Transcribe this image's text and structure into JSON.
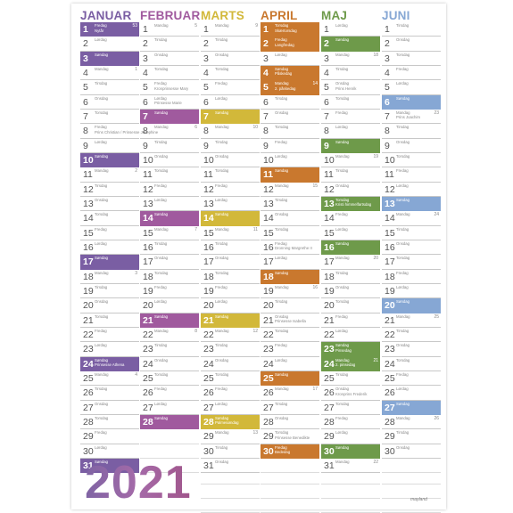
{
  "year": "2021",
  "brand": "mayland",
  "months": [
    {
      "name": "JANUAR",
      "color": "#7a5ea3",
      "days": [
        {
          "d": "1",
          "wd": "Fredag",
          "hol": "Nytår",
          "wk": "53",
          "hl": true
        },
        {
          "d": "2",
          "wd": "Lørdag"
        },
        {
          "d": "3",
          "wd": "Søndag",
          "hl": true
        },
        {
          "d": "4",
          "wd": "Mandag",
          "wk": "1"
        },
        {
          "d": "5",
          "wd": "Tirsdag"
        },
        {
          "d": "6",
          "wd": "Onsdag"
        },
        {
          "d": "7",
          "wd": "Torsdag"
        },
        {
          "d": "8",
          "wd": "Fredag",
          "hol": "Prins Christian / Prinsesse Josephine"
        },
        {
          "d": "9",
          "wd": "Lørdag"
        },
        {
          "d": "10",
          "wd": "Søndag",
          "hl": true
        },
        {
          "d": "11",
          "wd": "Mandag",
          "wk": "2"
        },
        {
          "d": "12",
          "wd": "Tirsdag"
        },
        {
          "d": "13",
          "wd": "Onsdag"
        },
        {
          "d": "14",
          "wd": "Torsdag"
        },
        {
          "d": "15",
          "wd": "Fredag"
        },
        {
          "d": "16",
          "wd": "Lørdag"
        },
        {
          "d": "17",
          "wd": "Søndag",
          "hl": true
        },
        {
          "d": "18",
          "wd": "Mandag",
          "wk": "3"
        },
        {
          "d": "19",
          "wd": "Tirsdag"
        },
        {
          "d": "20",
          "wd": "Onsdag"
        },
        {
          "d": "21",
          "wd": "Torsdag"
        },
        {
          "d": "22",
          "wd": "Fredag"
        },
        {
          "d": "23",
          "wd": "Lørdag"
        },
        {
          "d": "24",
          "wd": "Søndag",
          "hol": "Prinsesse Athena",
          "hl": true
        },
        {
          "d": "25",
          "wd": "Mandag",
          "wk": "4"
        },
        {
          "d": "26",
          "wd": "Tirsdag"
        },
        {
          "d": "27",
          "wd": "Onsdag"
        },
        {
          "d": "28",
          "wd": "Torsdag"
        },
        {
          "d": "29",
          "wd": "Fredag"
        },
        {
          "d": "30",
          "wd": "Lørdag"
        },
        {
          "d": "31",
          "wd": "Søndag",
          "hl": true
        }
      ]
    },
    {
      "name": "FEBRUAR",
      "color": "#a05a9e",
      "days": [
        {
          "d": "1",
          "wd": "Mandag",
          "wk": "5"
        },
        {
          "d": "2",
          "wd": "Tirsdag"
        },
        {
          "d": "3",
          "wd": "Onsdag"
        },
        {
          "d": "4",
          "wd": "Torsdag"
        },
        {
          "d": "5",
          "wd": "Fredag",
          "hol": "Kronprinsesse Mary"
        },
        {
          "d": "6",
          "wd": "Lørdag",
          "hol": "Prinsesse Marie"
        },
        {
          "d": "7",
          "wd": "Søndag",
          "hl": true
        },
        {
          "d": "8",
          "wd": "Mandag",
          "wk": "6"
        },
        {
          "d": "9",
          "wd": "Tirsdag"
        },
        {
          "d": "10",
          "wd": "Onsdag"
        },
        {
          "d": "11",
          "wd": "Torsdag"
        },
        {
          "d": "12",
          "wd": "Fredag"
        },
        {
          "d": "13",
          "wd": "Lørdag"
        },
        {
          "d": "14",
          "wd": "Søndag",
          "hl": true
        },
        {
          "d": "15",
          "wd": "Mandag",
          "wk": "7"
        },
        {
          "d": "16",
          "wd": "Tirsdag"
        },
        {
          "d": "17",
          "wd": "Onsdag"
        },
        {
          "d": "18",
          "wd": "Torsdag"
        },
        {
          "d": "19",
          "wd": "Fredag"
        },
        {
          "d": "20",
          "wd": "Lørdag"
        },
        {
          "d": "21",
          "wd": "Søndag",
          "hl": true
        },
        {
          "d": "22",
          "wd": "Mandag",
          "wk": "8"
        },
        {
          "d": "23",
          "wd": "Tirsdag"
        },
        {
          "d": "24",
          "wd": "Onsdag"
        },
        {
          "d": "25",
          "wd": "Torsdag"
        },
        {
          "d": "26",
          "wd": "Fredag"
        },
        {
          "d": "27",
          "wd": "Lørdag"
        },
        {
          "d": "28",
          "wd": "Søndag",
          "hl": true
        }
      ]
    },
    {
      "name": "MARTS",
      "color": "#d2b83a",
      "days": [
        {
          "d": "1",
          "wd": "Mandag",
          "wk": "9"
        },
        {
          "d": "2",
          "wd": "Tirsdag"
        },
        {
          "d": "3",
          "wd": "Onsdag"
        },
        {
          "d": "4",
          "wd": "Torsdag"
        },
        {
          "d": "5",
          "wd": "Fredag"
        },
        {
          "d": "6",
          "wd": "Lørdag"
        },
        {
          "d": "7",
          "wd": "Søndag",
          "hl": true
        },
        {
          "d": "8",
          "wd": "Mandag",
          "wk": "10"
        },
        {
          "d": "9",
          "wd": "Tirsdag"
        },
        {
          "d": "10",
          "wd": "Onsdag"
        },
        {
          "d": "11",
          "wd": "Torsdag"
        },
        {
          "d": "12",
          "wd": "Fredag"
        },
        {
          "d": "13",
          "wd": "Lørdag"
        },
        {
          "d": "14",
          "wd": "Søndag",
          "hl": true
        },
        {
          "d": "15",
          "wd": "Mandag",
          "wk": "11"
        },
        {
          "d": "16",
          "wd": "Tirsdag"
        },
        {
          "d": "17",
          "wd": "Onsdag"
        },
        {
          "d": "18",
          "wd": "Torsdag"
        },
        {
          "d": "19",
          "wd": "Fredag"
        },
        {
          "d": "20",
          "wd": "Lørdag"
        },
        {
          "d": "21",
          "wd": "Søndag",
          "hl": true
        },
        {
          "d": "22",
          "wd": "Mandag",
          "wk": "12"
        },
        {
          "d": "23",
          "wd": "Tirsdag"
        },
        {
          "d": "24",
          "wd": "Onsdag"
        },
        {
          "d": "25",
          "wd": "Torsdag"
        },
        {
          "d": "26",
          "wd": "Fredag"
        },
        {
          "d": "27",
          "wd": "Lørdag"
        },
        {
          "d": "28",
          "wd": "Søndag",
          "hol": "Palmesøndag",
          "hl": true
        },
        {
          "d": "29",
          "wd": "Mandag",
          "wk": "13"
        },
        {
          "d": "30",
          "wd": "Tirsdag"
        },
        {
          "d": "31",
          "wd": "Onsdag"
        }
      ]
    },
    {
      "name": "APRIL",
      "color": "#c9782e",
      "days": [
        {
          "d": "1",
          "wd": "Torsdag",
          "hol": "Skærtorsdag",
          "hl": true
        },
        {
          "d": "2",
          "wd": "Fredag",
          "hol": "Langfredag",
          "hl": true
        },
        {
          "d": "3",
          "wd": "Lørdag"
        },
        {
          "d": "4",
          "wd": "Søndag",
          "hol": "Påskedag",
          "hl": true
        },
        {
          "d": "5",
          "wd": "Mandag",
          "hol": "2. påskedag",
          "wk": "14",
          "hl": true
        },
        {
          "d": "6",
          "wd": "Tirsdag"
        },
        {
          "d": "7",
          "wd": "Onsdag"
        },
        {
          "d": "8",
          "wd": "Torsdag"
        },
        {
          "d": "9",
          "wd": "Fredag"
        },
        {
          "d": "10",
          "wd": "Lørdag"
        },
        {
          "d": "11",
          "wd": "Søndag",
          "hl": true
        },
        {
          "d": "12",
          "wd": "Mandag",
          "wk": "15"
        },
        {
          "d": "13",
          "wd": "Tirsdag"
        },
        {
          "d": "14",
          "wd": "Onsdag"
        },
        {
          "d": "15",
          "wd": "Torsdag"
        },
        {
          "d": "16",
          "wd": "Fredag",
          "hol": "Dronning Margrethe II"
        },
        {
          "d": "17",
          "wd": "Lørdag"
        },
        {
          "d": "18",
          "wd": "Søndag",
          "hl": true
        },
        {
          "d": "19",
          "wd": "Mandag",
          "wk": "16"
        },
        {
          "d": "20",
          "wd": "Tirsdag"
        },
        {
          "d": "21",
          "wd": "Onsdag",
          "hol": "Prinsesse Isabella"
        },
        {
          "d": "22",
          "wd": "Torsdag"
        },
        {
          "d": "23",
          "wd": "Fredag"
        },
        {
          "d": "24",
          "wd": "Lørdag"
        },
        {
          "d": "25",
          "wd": "Søndag",
          "hl": true
        },
        {
          "d": "26",
          "wd": "Mandag",
          "wk": "17"
        },
        {
          "d": "27",
          "wd": "Tirsdag"
        },
        {
          "d": "28",
          "wd": "Onsdag"
        },
        {
          "d": "29",
          "wd": "Torsdag",
          "hol": "Prinsesse Benedikte"
        },
        {
          "d": "30",
          "wd": "Fredag",
          "hol": "Bededag",
          "hl": true
        }
      ]
    },
    {
      "name": "MAJ",
      "color": "#6e9a4a",
      "days": [
        {
          "d": "1",
          "wd": "Lørdag"
        },
        {
          "d": "2",
          "wd": "Søndag",
          "hl": true
        },
        {
          "d": "3",
          "wd": "Mandag",
          "wk": "18"
        },
        {
          "d": "4",
          "wd": "Tirsdag"
        },
        {
          "d": "5",
          "wd": "Onsdag",
          "hol": "Prins Henrik"
        },
        {
          "d": "6",
          "wd": "Torsdag"
        },
        {
          "d": "7",
          "wd": "Fredag"
        },
        {
          "d": "8",
          "wd": "Lørdag"
        },
        {
          "d": "9",
          "wd": "Søndag",
          "hl": true
        },
        {
          "d": "10",
          "wd": "Mandag",
          "wk": "19"
        },
        {
          "d": "11",
          "wd": "Tirsdag"
        },
        {
          "d": "12",
          "wd": "Onsdag"
        },
        {
          "d": "13",
          "wd": "Torsdag",
          "hol": "Kristi himmelfartsdag",
          "hl": true
        },
        {
          "d": "14",
          "wd": "Fredag"
        },
        {
          "d": "15",
          "wd": "Lørdag"
        },
        {
          "d": "16",
          "wd": "Søndag",
          "hl": true
        },
        {
          "d": "17",
          "wd": "Mandag",
          "wk": "20"
        },
        {
          "d": "18",
          "wd": "Tirsdag"
        },
        {
          "d": "19",
          "wd": "Onsdag"
        },
        {
          "d": "20",
          "wd": "Torsdag"
        },
        {
          "d": "21",
          "wd": "Fredag"
        },
        {
          "d": "22",
          "wd": "Lørdag"
        },
        {
          "d": "23",
          "wd": "Søndag",
          "hol": "Pinsedag",
          "hl": true
        },
        {
          "d": "24",
          "wd": "Mandag",
          "hol": "2. pinsedag",
          "wk": "21",
          "hl": true
        },
        {
          "d": "25",
          "wd": "Tirsdag"
        },
        {
          "d": "26",
          "wd": "Onsdag",
          "hol": "Kronprins Frederik"
        },
        {
          "d": "27",
          "wd": "Torsdag"
        },
        {
          "d": "28",
          "wd": "Fredag"
        },
        {
          "d": "29",
          "wd": "Lørdag"
        },
        {
          "d": "30",
          "wd": "Søndag",
          "hl": true
        },
        {
          "d": "31",
          "wd": "Mandag",
          "wk": "22"
        }
      ]
    },
    {
      "name": "JUNI",
      "color": "#86a7d4",
      "days": [
        {
          "d": "1",
          "wd": "Tirsdag"
        },
        {
          "d": "2",
          "wd": "Onsdag"
        },
        {
          "d": "3",
          "wd": "Torsdag"
        },
        {
          "d": "4",
          "wd": "Fredag"
        },
        {
          "d": "5",
          "wd": "Lørdag"
        },
        {
          "d": "6",
          "wd": "Søndag",
          "hl": true
        },
        {
          "d": "7",
          "wd": "Mandag",
          "hol": "Prins Joachim",
          "wk": "23"
        },
        {
          "d": "8",
          "wd": "Tirsdag"
        },
        {
          "d": "9",
          "wd": "Onsdag"
        },
        {
          "d": "10",
          "wd": "Torsdag"
        },
        {
          "d": "11",
          "wd": "Fredag"
        },
        {
          "d": "12",
          "wd": "Lørdag"
        },
        {
          "d": "13",
          "wd": "Søndag",
          "hl": true
        },
        {
          "d": "14",
          "wd": "Mandag",
          "wk": "24"
        },
        {
          "d": "15",
          "wd": "Tirsdag"
        },
        {
          "d": "16",
          "wd": "Onsdag"
        },
        {
          "d": "17",
          "wd": "Torsdag"
        },
        {
          "d": "18",
          "wd": "Fredag"
        },
        {
          "d": "19",
          "wd": "Lørdag"
        },
        {
          "d": "20",
          "wd": "Søndag",
          "hl": true
        },
        {
          "d": "21",
          "wd": "Mandag",
          "wk": "25"
        },
        {
          "d": "22",
          "wd": "Tirsdag"
        },
        {
          "d": "23",
          "wd": "Onsdag"
        },
        {
          "d": "24",
          "wd": "Torsdag"
        },
        {
          "d": "25",
          "wd": "Fredag"
        },
        {
          "d": "26",
          "wd": "Lørdag"
        },
        {
          "d": "27",
          "wd": "Søndag",
          "hl": true
        },
        {
          "d": "28",
          "wd": "Mandag",
          "wk": "26"
        },
        {
          "d": "29",
          "wd": "Tirsdag"
        },
        {
          "d": "30",
          "wd": "Onsdag"
        }
      ]
    }
  ]
}
